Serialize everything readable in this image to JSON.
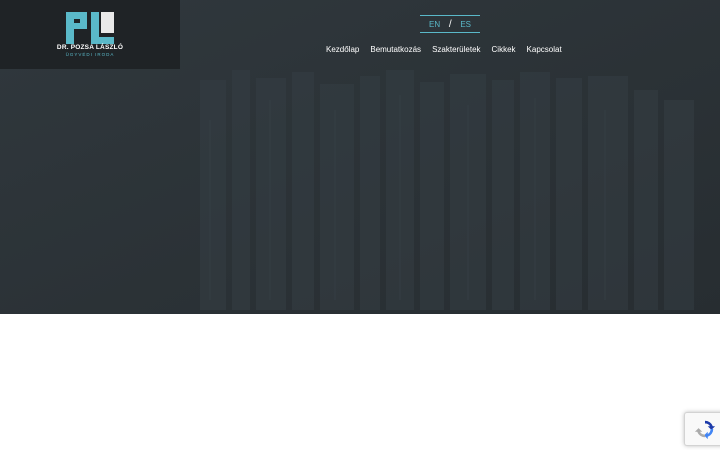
{
  "brand": {
    "name": "DR. POZSA LÁSZLÓ",
    "subtitle": "ÜGYVÉDI IRODA",
    "accent_color": "#5ab9c9",
    "logo_icon": "pl-monogram-icon"
  },
  "language_switcher": {
    "options": [
      "EN",
      "ES"
    ],
    "separator": "/"
  },
  "nav": {
    "items": [
      "Kezdőlap",
      "Bemutatkozás",
      "Szakterületek",
      "Cikkek",
      "Kapcsolat"
    ]
  },
  "colors": {
    "hero_bg": "#2d3439",
    "logo_bg": "#1f2326",
    "nav_text": "#ffffff"
  },
  "recaptcha": {
    "icon": "recaptcha-icon"
  }
}
